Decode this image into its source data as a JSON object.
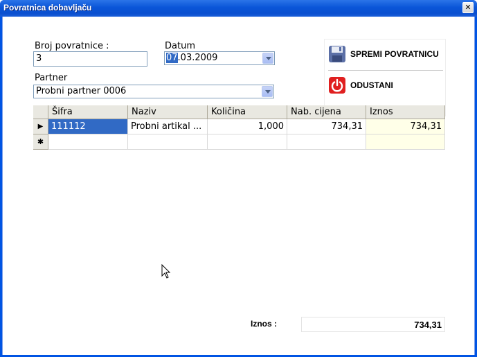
{
  "window": {
    "title": "Povratnica dobavljaču",
    "close_glyph": "✕"
  },
  "form": {
    "broj_label": "Broj povratnice :",
    "broj_value": "3",
    "datum_label": "Datum",
    "datum_day": "07",
    "datum_rest": ".03.2009",
    "partner_label": "Partner",
    "partner_value": "Probni partner 0006"
  },
  "actions": {
    "save_label": "SPREMI POVRATNICU",
    "save_icon": "floppy-disk-icon",
    "cancel_label": "ODUSTANI",
    "cancel_icon": "power-icon",
    "cancel_color": "#e02020"
  },
  "grid": {
    "columns": [
      "Šifra",
      "Naziv",
      "Količina",
      "Nab. cijena",
      "Iznos"
    ],
    "rows": [
      {
        "sifra": "111112",
        "naziv": "Probni artikal ...",
        "kolicina": "1,000",
        "nab_cijena": "734,31",
        "iznos": "734,31"
      }
    ],
    "current_row_marker": "▶",
    "new_row_marker": "✱",
    "selection_color": "#316ac5"
  },
  "summary": {
    "label": "Iznos :",
    "value": "734,31"
  }
}
